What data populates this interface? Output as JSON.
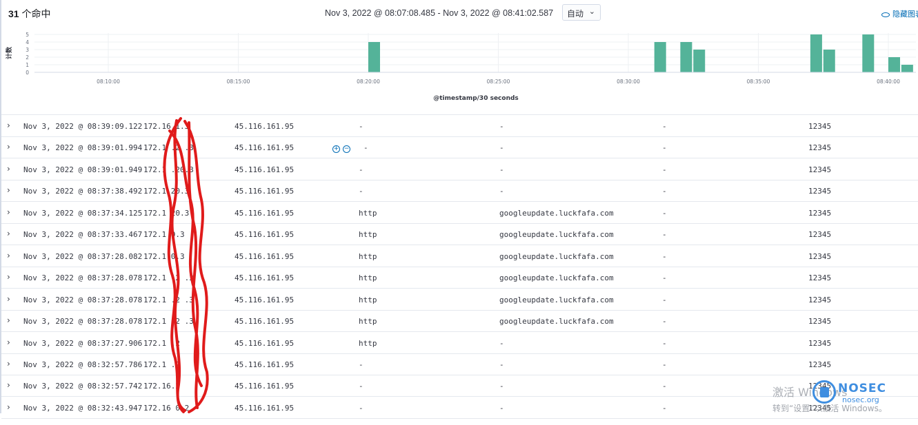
{
  "header": {
    "hits_count": "31",
    "hits_suffix": "个命中",
    "time_range": "Nov 3, 2022 @ 08:07:08.485 - Nov 3, 2022 @ 08:41:02.587",
    "interval": "自动",
    "hide_chart_label": "隐藏图表"
  },
  "chart_data": {
    "type": "bar",
    "ylabel": "计数",
    "xlabel": "@timestamp/30 seconds",
    "yticks": [
      "5",
      "4",
      "3",
      "2",
      "1",
      "0"
    ],
    "ylim": [
      0,
      5
    ],
    "xticks": [
      "08:10:00",
      "08:15:00",
      "08:20:00",
      "08:25:00",
      "08:30:00",
      "08:35:00",
      "08:40:00"
    ],
    "bar_color": "#54b399",
    "bars": [
      {
        "t": "08:20:00",
        "count": 4
      },
      {
        "t": "08:31:00",
        "count": 4
      },
      {
        "t": "08:32:00",
        "count": 4
      },
      {
        "t": "08:32:30",
        "count": 3
      },
      {
        "t": "08:37:00",
        "count": 5
      },
      {
        "t": "08:37:30",
        "count": 3
      },
      {
        "t": "08:39:00",
        "count": 5
      },
      {
        "t": "08:40:00",
        "count": 2
      },
      {
        "t": "08:40:30",
        "count": 1
      }
    ],
    "grid": true
  },
  "rows": [
    {
      "time": "Nov 3, 2022 @ 08:39:09.122",
      "src": "172.16.1.3",
      "dst": "45.116.161.95",
      "proto": "-",
      "host": "-",
      "dash": "-",
      "port": "12345"
    },
    {
      "time": "Nov 3, 2022 @ 08:39:01.994",
      "src": "172.1 .2 .3",
      "dst": "45.116.161.95",
      "proto": "-",
      "host": "-",
      "dash": "-",
      "port": "12345"
    },
    {
      "time": "Nov 3, 2022 @ 08:39:01.949",
      "src": "172.1 .20.3",
      "dst": "45.116.161.95",
      "proto": "-",
      "host": "-",
      "dash": "-",
      "port": "12345"
    },
    {
      "time": "Nov 3, 2022 @ 08:37:38.492",
      "src": "172.1 20.3",
      "dst": "45.116.161.95",
      "proto": "-",
      "host": "-",
      "dash": "-",
      "port": "12345"
    },
    {
      "time": "Nov 3, 2022 @ 08:37:34.125",
      "src": "172.1 20.3",
      "dst": "45.116.161.95",
      "proto": "http",
      "host": "googleupdate.luckfafa.com",
      "dash": "-",
      "port": "12345"
    },
    {
      "time": "Nov 3, 2022 @ 08:37:33.467",
      "src": "172.1 0.3",
      "dst": "45.116.161.95",
      "proto": "http",
      "host": "googleupdate.luckfafa.com",
      "dash": "-",
      "port": "12345"
    },
    {
      "time": "Nov 3, 2022 @ 08:37:28.082",
      "src": "172.1 0.3",
      "dst": "45.116.161.95",
      "proto": "http",
      "host": "googleupdate.luckfafa.com",
      "dash": "-",
      "port": "12345"
    },
    {
      "time": "Nov 3, 2022 @ 08:37:28.078",
      "src": "172.1 .2 .3",
      "dst": "45.116.161.95",
      "proto": "http",
      "host": "googleupdate.luckfafa.com",
      "dash": "-",
      "port": "12345"
    },
    {
      "time": "Nov 3, 2022 @ 08:37:28.078",
      "src": "172.1 .2 .3",
      "dst": "45.116.161.95",
      "proto": "http",
      "host": "googleupdate.luckfafa.com",
      "dash": "-",
      "port": "12345"
    },
    {
      "time": "Nov 3, 2022 @ 08:37:28.078",
      "src": "172.1 .2 .3",
      "dst": "45.116.161.95",
      "proto": "http",
      "host": "googleupdate.luckfafa.com",
      "dash": "-",
      "port": "12345"
    },
    {
      "time": "Nov 3, 2022 @ 08:37:27.906",
      "src": "172.1 .2",
      "dst": "45.116.161.95",
      "proto": "http",
      "host": "-",
      "dash": "-",
      "port": "12345"
    },
    {
      "time": "Nov 3, 2022 @ 08:32:57.786",
      "src": "172.1 .2",
      "dst": "45.116.161.95",
      "proto": "-",
      "host": "-",
      "dash": "-",
      "port": "12345"
    },
    {
      "time": "Nov 3, 2022 @ 08:32:57.742",
      "src": "172.16.2",
      "dst": "45.116.161.95",
      "proto": "-",
      "host": "-",
      "dash": "-",
      "port": "12345"
    },
    {
      "time": "Nov 3, 2022 @ 08:32:43.947",
      "src": "172.16 0.2",
      "dst": "45.116.161.95",
      "proto": "-",
      "host": "-",
      "dash": "-",
      "port": "12345"
    }
  ],
  "filter_icons": {
    "plus": "+",
    "minus": "−"
  },
  "watermark": {
    "line1": "激活 Windows",
    "line2": "转到“设置”以激活 Windows。",
    "brand": "NOSEC",
    "brand_url": "nosec.org"
  },
  "colors": {
    "accent": "#006bb4",
    "bar": "#54b399",
    "scribble": "#e01b1b"
  }
}
